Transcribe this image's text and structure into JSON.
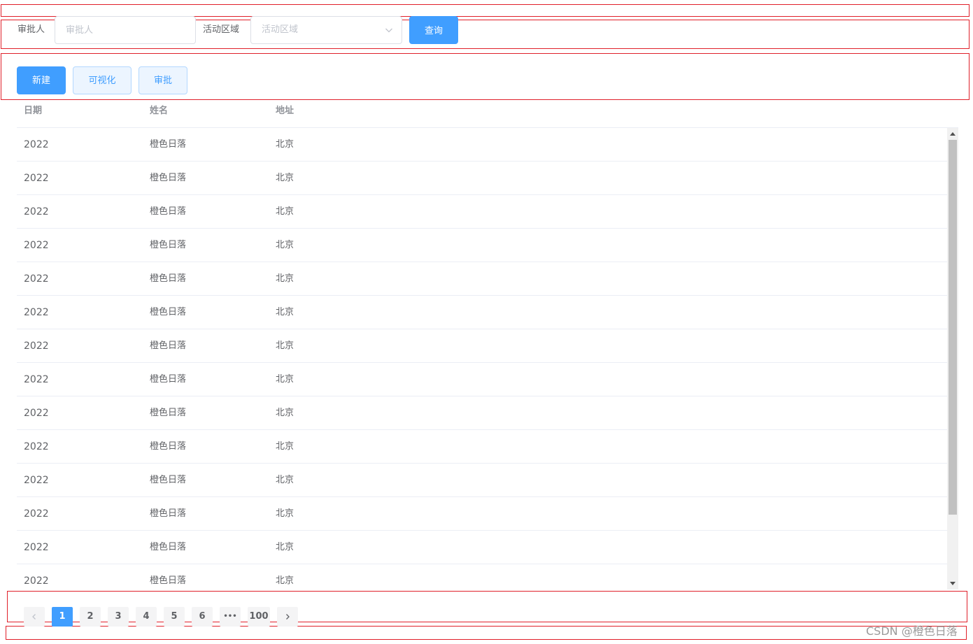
{
  "search": {
    "approver_label": "审批人",
    "approver_placeholder": "审批人",
    "region_label": "活动区域",
    "region_placeholder": "活动区域",
    "query_button": "查询"
  },
  "toolbar": {
    "new_button": "新建",
    "visualize_button": "可视化",
    "approve_button": "审批"
  },
  "table": {
    "columns": [
      "日期",
      "姓名",
      "地址"
    ],
    "rows": [
      [
        "2022",
        "橙色日落",
        "北京"
      ],
      [
        "2022",
        "橙色日落",
        "北京"
      ],
      [
        "2022",
        "橙色日落",
        "北京"
      ],
      [
        "2022",
        "橙色日落",
        "北京"
      ],
      [
        "2022",
        "橙色日落",
        "北京"
      ],
      [
        "2022",
        "橙色日落",
        "北京"
      ],
      [
        "2022",
        "橙色日落",
        "北京"
      ],
      [
        "2022",
        "橙色日落",
        "北京"
      ],
      [
        "2022",
        "橙色日落",
        "北京"
      ],
      [
        "2022",
        "橙色日落",
        "北京"
      ],
      [
        "2022",
        "橙色日落",
        "北京"
      ],
      [
        "2022",
        "橙色日落",
        "北京"
      ],
      [
        "2022",
        "橙色日落",
        "北京"
      ],
      [
        "2022",
        "橙色日落",
        "北京"
      ]
    ]
  },
  "pagination": {
    "prev_icon": "chevron-left-icon",
    "next_icon": "chevron-right-icon",
    "pages": [
      "1",
      "2",
      "3",
      "4",
      "5",
      "6",
      "•••",
      "100"
    ],
    "current": "1"
  },
  "watermark": "CSDN @橙色日落",
  "colors": {
    "primary": "#409eff",
    "primary_light": "#ecf5ff",
    "outline": "#e0202a"
  }
}
